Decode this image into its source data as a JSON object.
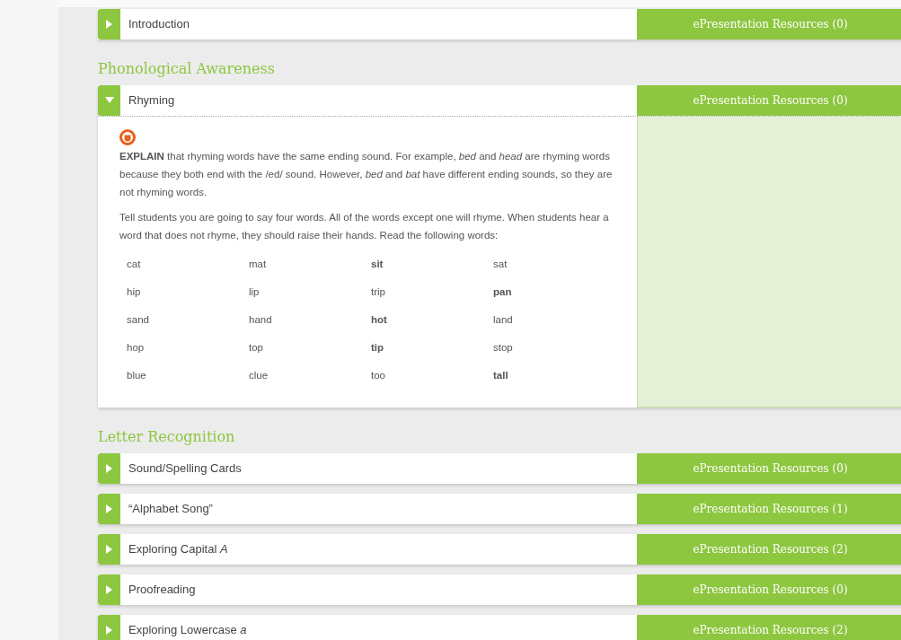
{
  "groups": [
    {
      "items": [
        {
          "title": "Introduction",
          "expanded": false,
          "resources": "ePresentation Resources (0)"
        }
      ]
    },
    {
      "heading": "Phonological Awareness",
      "items": [
        {
          "title": "Rhyming",
          "expanded": true,
          "resources": "ePresentation Resources (0)",
          "body": {
            "paragraphs": [
              "**EXPLAIN** that rhyming words have the same ending sound. For example, *bed* and *head* are rhyming words because they both end with the /ed/ sound. However, *bed* and *bat* have different ending sounds, so they are not rhyming words.",
              "Tell students you are going to say four words. All of the words except one will rhyme. When students hear a word that does not rhyme, they should raise their hands. Read the following words:"
            ],
            "word_rows": [
              [
                {
                  "text": "cat",
                  "bold": false
                },
                {
                  "text": "mat",
                  "bold": false
                },
                {
                  "text": "sit",
                  "bold": true
                },
                {
                  "text": "sat",
                  "bold": false
                }
              ],
              [
                {
                  "text": "hip",
                  "bold": false
                },
                {
                  "text": "lip",
                  "bold": false
                },
                {
                  "text": "trip",
                  "bold": false
                },
                {
                  "text": "pan",
                  "bold": true
                }
              ],
              [
                {
                  "text": "sand",
                  "bold": false
                },
                {
                  "text": "hand",
                  "bold": false
                },
                {
                  "text": "hot",
                  "bold": true
                },
                {
                  "text": "land",
                  "bold": false
                }
              ],
              [
                {
                  "text": "hop",
                  "bold": false
                },
                {
                  "text": "top",
                  "bold": false
                },
                {
                  "text": "tip",
                  "bold": true
                },
                {
                  "text": "stop",
                  "bold": false
                }
              ],
              [
                {
                  "text": "blue",
                  "bold": false
                },
                {
                  "text": "clue",
                  "bold": false
                },
                {
                  "text": "too",
                  "bold": false
                },
                {
                  "text": "tall",
                  "bold": true
                }
              ]
            ]
          }
        }
      ]
    },
    {
      "heading": "Letter Recognition",
      "items": [
        {
          "title": "Sound/Spelling Cards",
          "expanded": false,
          "resources": "ePresentation Resources (0)"
        },
        {
          "title": "“Alphabet Song”",
          "expanded": false,
          "resources": "ePresentation Resources (1)"
        },
        {
          "title": "Exploring Capital *A*",
          "expanded": false,
          "resources": "ePresentation Resources (2)"
        },
        {
          "title": "Proofreading",
          "expanded": false,
          "resources": "ePresentation Resources (0)"
        },
        {
          "title": "Exploring Lowercase *a*",
          "expanded": false,
          "resources": "ePresentation Resources (2)"
        }
      ]
    }
  ]
}
